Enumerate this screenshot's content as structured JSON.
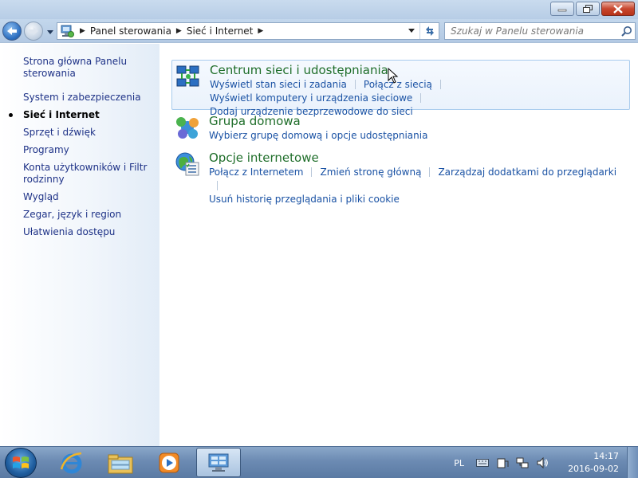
{
  "window": {
    "controls": {
      "minimize": "minimize-icon",
      "maximize": "restore-icon",
      "close": "close-icon"
    }
  },
  "address": {
    "breadcrumbs": [
      "Panel sterowania",
      "Sieć i Internet"
    ],
    "search_placeholder": "Szukaj w Panelu sterowania"
  },
  "sidebar": {
    "home_link": "Strona główna Panelu sterowania",
    "items": [
      "System i zabezpieczenia",
      "Sieć i Internet",
      "Sprzęt i dźwięk",
      "Programy",
      "Konta użytkowników i Filtr rodzinny",
      "Wygląd",
      "Zegar, język i region",
      "Ułatwienia dostępu"
    ],
    "active_index": 1
  },
  "categories": [
    {
      "title": "Centrum sieci i udostępniania",
      "icon": "network-center-icon",
      "links": [
        "Wyświetl stan sieci i zadania",
        "Połącz z siecią",
        "Wyświetl komputery i urządzenia sieciowe",
        "Dodaj urządzenie bezprzewodowe do sieci"
      ]
    },
    {
      "title": "Grupa domowa",
      "icon": "homegroup-icon",
      "links": [
        "Wybierz grupę domową i opcje udostępniania"
      ]
    },
    {
      "title": "Opcje internetowe",
      "icon": "internet-options-icon",
      "links": [
        "Połącz z Internetem",
        "Zmień stronę główną",
        "Zarządzaj dodatkami do przeglądarki",
        "Usuń historię przeglądania i pliki cookie"
      ]
    }
  ],
  "taskbar": {
    "items": [
      "internet-explorer-icon",
      "windows-explorer-icon",
      "media-player-icon",
      "control-panel-icon"
    ],
    "language": "PL",
    "time": "14:17",
    "date": "2016-09-02"
  },
  "colors": {
    "category_title": "#1f6e2a",
    "link": "#1a52a4",
    "sidebar_link": "#1e3287",
    "taskbar": "#6c8bb3"
  }
}
